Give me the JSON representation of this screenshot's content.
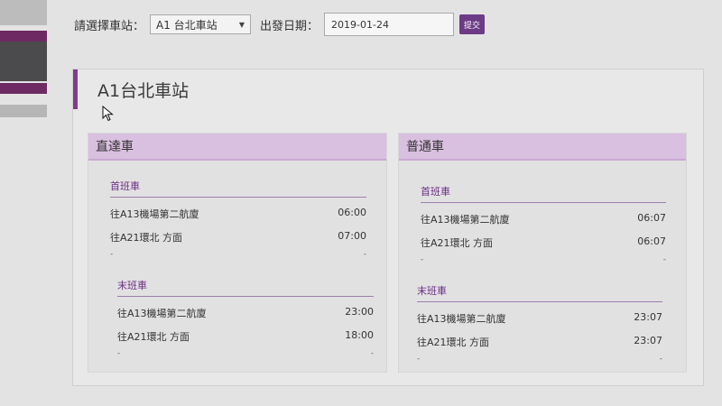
{
  "toolbar": {
    "station_label": "請選擇車站：",
    "station_value": "A1 台北車站",
    "date_label": "出發日期：",
    "date_value": "2019-01-24",
    "submit_label": "提交"
  },
  "card": {
    "title": "A1台北車站"
  },
  "express": {
    "title": "直達車",
    "first": {
      "title": "首班車",
      "rows": [
        {
          "dest": "往A13機場第二航廈",
          "time": "06:00"
        },
        {
          "dest": "往A21環北 方面",
          "time": "07:00"
        },
        {
          "dest": "-",
          "time": "-"
        }
      ]
    },
    "last": {
      "title": "末班車",
      "rows": [
        {
          "dest": "往A13機場第二航廈",
          "time": "23:00"
        },
        {
          "dest": "往A21環北 方面",
          "time": "18:00"
        },
        {
          "dest": "-",
          "time": "-"
        }
      ]
    }
  },
  "commuter": {
    "title": "普通車",
    "first": {
      "title": "首班車",
      "rows": [
        {
          "dest": "往A13機場第二航廈",
          "time": "06:07"
        },
        {
          "dest": "往A21環北 方面",
          "time": "06:07"
        },
        {
          "dest": "-",
          "time": "-"
        }
      ]
    },
    "last": {
      "title": "末班車",
      "rows": [
        {
          "dest": "往A13機場第二航廈",
          "time": "23:07"
        },
        {
          "dest": "往A21環北 方面",
          "time": "23:07"
        },
        {
          "dest": "-",
          "time": "-"
        }
      ]
    }
  }
}
